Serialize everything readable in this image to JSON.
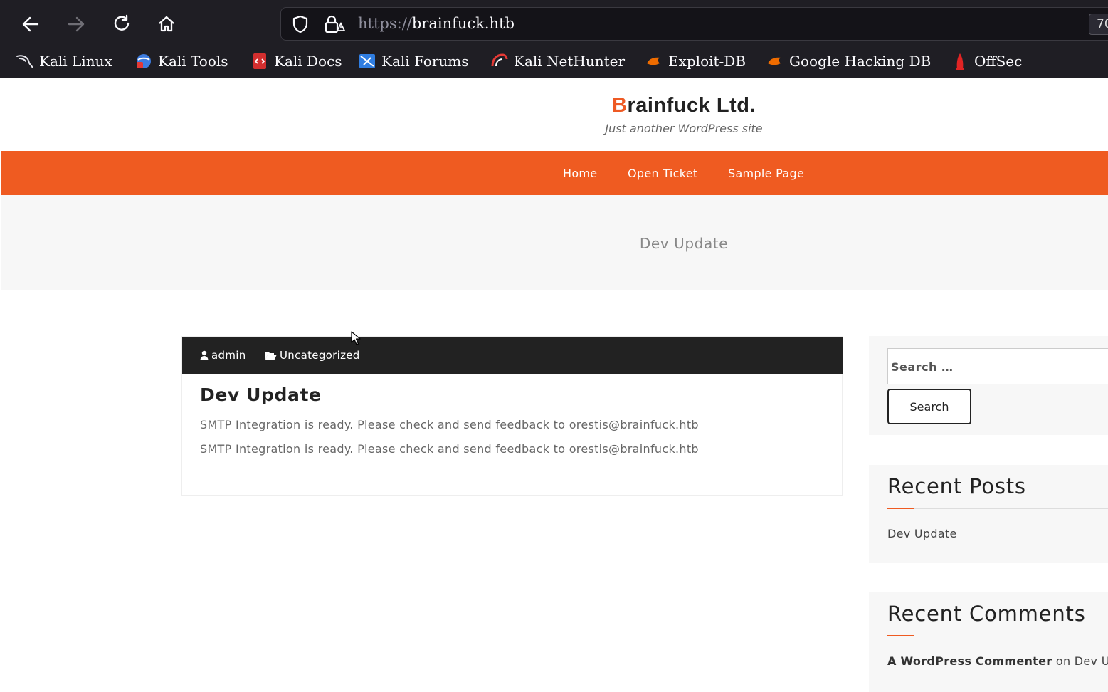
{
  "browser": {
    "url_scheme": "https://",
    "url_host": "brainfuck.htb",
    "zoom_label": "70",
    "bookmarks": [
      {
        "label": "Kali Linux",
        "icon": "kali-dragon-icon"
      },
      {
        "label": "Kali Tools",
        "icon": "kali-tools-icon"
      },
      {
        "label": "Kali Docs",
        "icon": "kali-docs-icon"
      },
      {
        "label": "Kali Forums",
        "icon": "kali-forums-icon"
      },
      {
        "label": "Kali NetHunter",
        "icon": "kali-nethunter-icon"
      },
      {
        "label": "Exploit-DB",
        "icon": "exploit-db-icon"
      },
      {
        "label": "Google Hacking DB",
        "icon": "ghdb-icon"
      },
      {
        "label": "OffSec",
        "icon": "offsec-icon"
      }
    ]
  },
  "site": {
    "title_first": "B",
    "title_rest": "rainfuck Ltd.",
    "tagline": "Just another WordPress site",
    "accent_color": "#ef5b21",
    "menu": [
      "Home",
      "Open Ticket",
      "Sample Page"
    ],
    "banner_title": "Dev Update"
  },
  "post": {
    "author": "admin",
    "category": "Uncategorized",
    "title": "Dev Update",
    "lines": [
      "SMTP Integration is ready. Please check and send feedback to orestis@brainfuck.htb",
      "SMTP Integration is ready. Please check and send feedback to orestis@brainfuck.htb"
    ]
  },
  "sidebar": {
    "search_placeholder": "Search …",
    "search_button": "Search",
    "recent_posts_title": "Recent Posts",
    "recent_posts": [
      "Dev Update"
    ],
    "recent_comments_title": "Recent Comments",
    "comment_author": "A WordPress Commenter",
    "comment_on": "on",
    "comment_post": "Dev Up"
  }
}
